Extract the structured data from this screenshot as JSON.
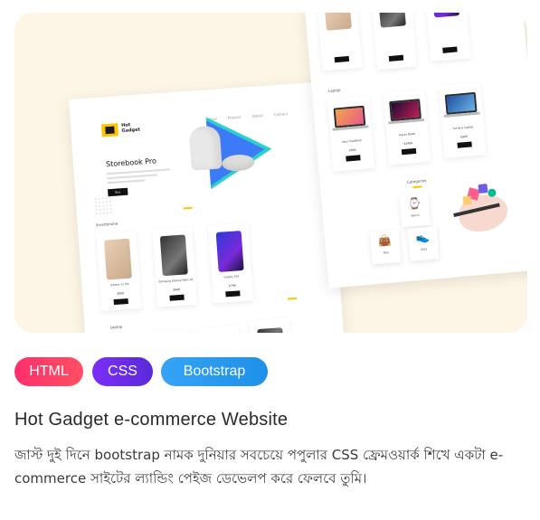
{
  "thumbnail": {
    "left_page": {
      "hero_title": "Storebook Pro",
      "section_smartphone": "Smartphone",
      "section_laptop": "Laptop",
      "products": [
        {
          "name": "iPhone 11 Pro",
          "price": "$999"
        },
        {
          "name": "Samsung Galaxy Note 10",
          "price": "$949"
        },
        {
          "name": "Galaxy S21",
          "price": "$799"
        }
      ]
    },
    "right_page": {
      "section_laptop": "Laptop",
      "section_category": "Categories",
      "laptops": [
        {
          "name": "Asus VivoBook",
          "price": "$599"
        },
        {
          "name": "Razer Blade",
          "price": "$1499"
        },
        {
          "name": "Surface Laptop",
          "price": "$999"
        }
      ],
      "categories": [
        {
          "name": "Watch",
          "icon": "⌚"
        },
        {
          "name": "Bag",
          "icon": "👜"
        },
        {
          "name": "Shoe",
          "icon": "👟"
        }
      ]
    }
  },
  "tags": [
    "HTML",
    "CSS",
    "Bootstrap"
  ],
  "colors": {
    "html": "#ff2f6d",
    "css": "#7b2ff7",
    "bootstrap": "#36a3f7",
    "thumb_bg": "#fdf6e6"
  },
  "title": "Hot Gadget e-commerce Website",
  "description": "জাস্ট দুই দিনে bootstrap নামক দুনিয়ার সবচেয়ে পপুলার CSS ফ্রেমওয়ার্ক শিখে একটা e-commerce সাইটের ল্যান্ডিং পেইজ ডেভেলপ করে ফেলবে তুমি।"
}
